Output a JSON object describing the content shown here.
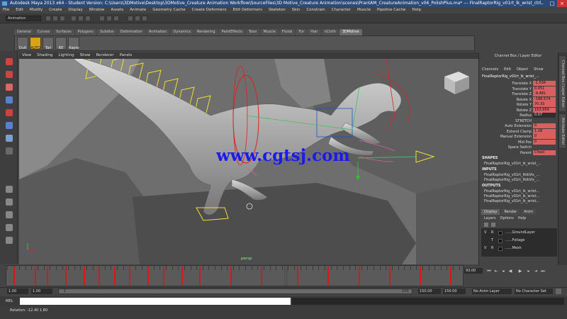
{
  "window": {
    "title": "Autodesk Maya 2013 x64 - Student Version: C:\\Users\\3DMotive\\Desktop\\3DMotive_Creature Animation Workflow\\SourceFiles\\3D Motive_Creature Animation\\scenes\\PrantAM_CreatureAnimation_v06_PolishPlus.ma* --- FinalRaptorRig_v01rt_lk_wrist_ctrl"
  },
  "menubar": [
    "File",
    "Edit",
    "Modify",
    "Create",
    "Display",
    "Window",
    "Assets",
    "Animate",
    "Geometry Cache",
    "Create Deformers",
    "Edit Deformers",
    "Skeleton",
    "Skin",
    "Constrain",
    "Character",
    "Muscle",
    "Pipeline Cache",
    "Help"
  ],
  "status": {
    "mode": "Animation"
  },
  "shelf": {
    "tabs": [
      "General",
      "Curves",
      "Surfaces",
      "Polygons",
      "Subdivs",
      "Deformation",
      "Animation",
      "Dynamics",
      "Rendering",
      "PaintEffects",
      "Toon",
      "Muscle",
      "Fluids",
      "Fur",
      "Hair",
      "nCloth",
      "3DMotive"
    ],
    "active_tab": "3DMotive",
    "buttons": [
      "Outl",
      "AUTO",
      "Tail",
      "RE",
      "Rapto"
    ]
  },
  "viewport": {
    "menu": [
      "View",
      "Shading",
      "Lighting",
      "Show",
      "Renderer",
      "Panels"
    ],
    "camera_label": "persp",
    "watermark": "www.cgtsj.com"
  },
  "channel_box": {
    "tabs": [
      "Channel Box / Layer Editor"
    ],
    "menu": [
      "Channels",
      "Edit",
      "Object",
      "Show"
    ],
    "object_name": "FinalRaptorRig_v01rt_lk_wrist_...",
    "channels": [
      {
        "label": "Translate X",
        "value": "-1.534",
        "style": "key"
      },
      {
        "label": "Translate Y",
        "value": "0.051",
        "style": "key"
      },
      {
        "label": "Translate Z",
        "value": "-9.481",
        "style": "key"
      },
      {
        "label": "Rotate X",
        "value": "-188.574",
        "style": "key"
      },
      {
        "label": "Rotate Y",
        "value": "70.33",
        "style": "key"
      },
      {
        "label": "Rotate Z",
        "value": "153.959",
        "style": "key"
      },
      {
        "label": "Radius",
        "value": "0.07",
        "style": "none"
      },
      {
        "label": "STRETCH",
        "value": "",
        "style": "none"
      },
      {
        "label": "Auto Extension",
        "value": "0",
        "style": "key"
      },
      {
        "label": "Extend Clamp",
        "value": "1.28",
        "style": "key"
      },
      {
        "label": "Manual Extension",
        "value": "0",
        "style": "key"
      },
      {
        "label": "Mid Pos",
        "value": "0",
        "style": "key"
      },
      {
        "label": "Space Switch",
        "value": "",
        "style": "none"
      },
      {
        "label": "Parent",
        "value": "Chest",
        "style": "key"
      }
    ],
    "sections": {
      "shapes": {
        "title": "SHAPES",
        "items": [
          "FinalRaptorRig_v01rt_lk_wrist_..."
        ]
      },
      "inputs": {
        "title": "INPUTS",
        "items": [
          "FinalRaptorRig_v01rt_fkIkVis_...",
          "FinalRaptorRig_v01rt_fkIkVis_..."
        ]
      },
      "outputs": {
        "title": "OUTPUTS",
        "items": [
          "FinalRaptorRig_v01rt_lk_wrist...",
          "FinalRaptorRig_v01rt_lk_wrist...",
          "FinalRaptorRig_v01rt_lk_wrist..."
        ]
      }
    }
  },
  "side_tabs": [
    "Channel Box / Layer Editor",
    "Attribute Editor"
  ],
  "layer_editor": {
    "tabs": [
      "Display",
      "Render",
      "Anim"
    ],
    "active_tab": "Display",
    "menu": [
      "Layers",
      "Options",
      "Help"
    ],
    "layers": [
      {
        "v": "V",
        "r": "R",
        "name": "......GroundLayer"
      },
      {
        "v": "",
        "r": "T",
        "name": "......Foliage"
      },
      {
        "v": "V",
        "r": "R",
        "name": "......Mesh"
      }
    ]
  },
  "timeline": {
    "current_frame": "93.00",
    "playhead_frame": 92,
    "range_start": 1,
    "range_end": 150,
    "key_frames": [
      3,
      10,
      14,
      20,
      26,
      31,
      36,
      41,
      47,
      52,
      58,
      64,
      74,
      84,
      96,
      106,
      116,
      126,
      136,
      146
    ]
  },
  "range": {
    "start_time": "1.00",
    "playback_start": "1.00",
    "slider_start": "1",
    "slider_end": "150",
    "playback_end": "150.00",
    "end_time": "150.00",
    "anim_layer": "No Anim Layer",
    "character_set": "No Character Set"
  },
  "command_line": {
    "label": "MEL"
  },
  "help_line": {
    "text": "Rotation: -12.40    1.80"
  },
  "colors": {
    "key": "#d21a1a",
    "title_bar": "#2c4a78",
    "selected_shelf": "#d8a412"
  }
}
